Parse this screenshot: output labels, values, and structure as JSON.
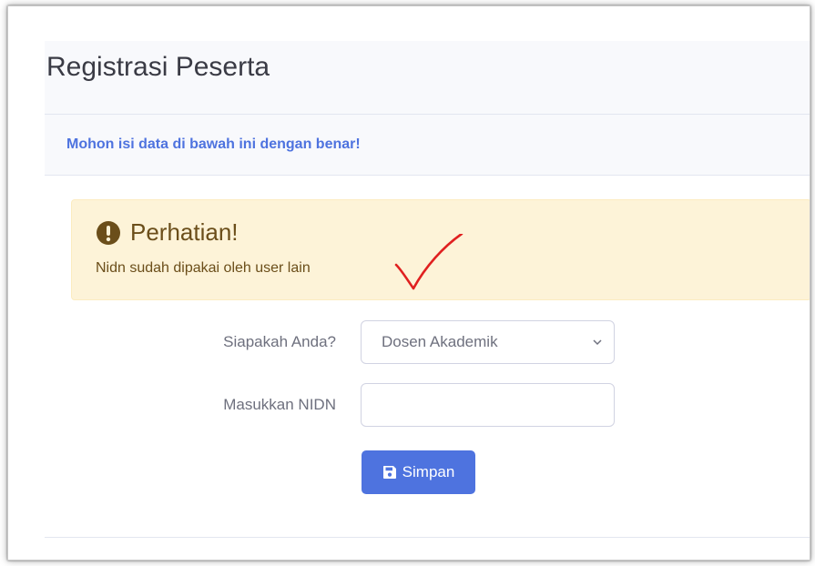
{
  "header": {
    "title": "Registrasi Peserta"
  },
  "subheader": {
    "text": "Mohon isi data di bawah ini dengan benar!"
  },
  "alert": {
    "icon": "exclamation-circle-icon",
    "title": "Perhatian!",
    "message": "Nidn sudah dipakai oleh user lain"
  },
  "form": {
    "role_label": "Siapakah Anda?",
    "role_value": "Dosen Akademik",
    "nidn_label": "Masukkan NIDN",
    "nidn_value": ""
  },
  "actions": {
    "save_label": "Simpan",
    "save_icon": "save-icon"
  },
  "colors": {
    "primary": "#4e73df",
    "alert_bg": "#fdf3d8",
    "alert_text": "#6b4e1a",
    "annotation": "#e02020"
  }
}
